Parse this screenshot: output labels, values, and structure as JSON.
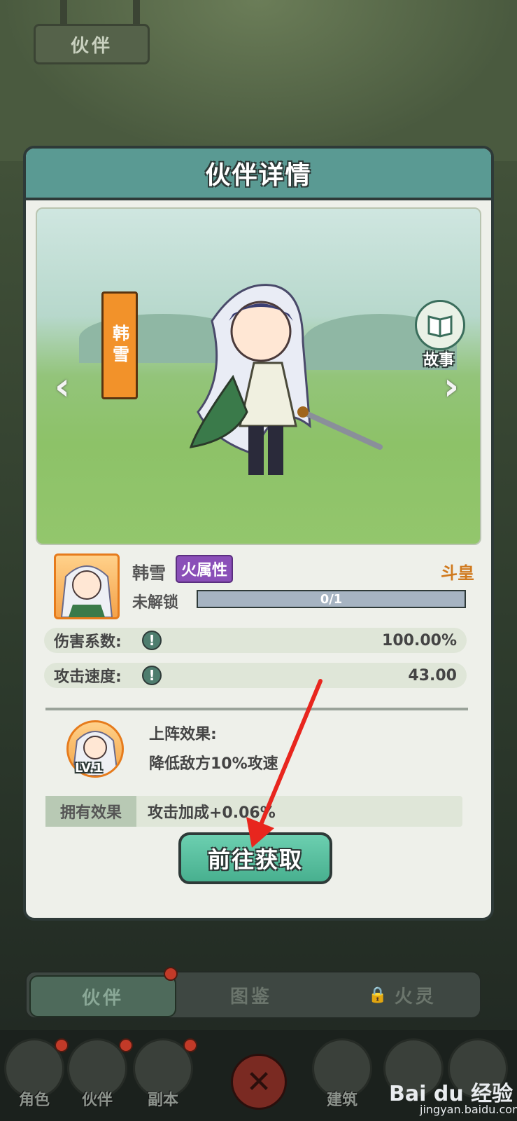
{
  "top_tab": {
    "label": "伙伴"
  },
  "dialog": {
    "title": "伙伴详情",
    "character_banner": "韩雪",
    "story_label": "故事"
  },
  "partner": {
    "name": "韩雪",
    "attribute": "火属性",
    "rank": "斗皇",
    "unlock_label": "未解锁",
    "unlock_progress": "0/1",
    "unlock_progress_fraction": 0
  },
  "stats": [
    {
      "label": "伤害系数:",
      "value": "100.00%"
    },
    {
      "label": "攻击速度:",
      "value": "43.00"
    }
  ],
  "skill": {
    "level": "LV.1",
    "effect_title": "上阵效果:",
    "effect_text": "降低敌方10%攻速"
  },
  "owned_effect": {
    "label": "拥有效果",
    "value": "攻击加成+0.06%"
  },
  "actions": {
    "goto_label": "前往获取"
  },
  "sub_tabs": [
    {
      "label": "伙伴",
      "active": true
    },
    {
      "label": "图鉴",
      "active": false
    },
    {
      "label": "火灵",
      "active": false
    }
  ],
  "bottom_nav": [
    {
      "label": "角色"
    },
    {
      "label": "伙伴"
    },
    {
      "label": "副本"
    },
    {
      "label": "建筑"
    }
  ],
  "watermark": {
    "main": "Bai du 经验",
    "sub": "jingyan.baidu.com"
  },
  "colors": {
    "accent": "#5a9a93",
    "attribute_badge": "#8a4fb8",
    "rank": "#d07a1e",
    "goto_button": "#48b08f",
    "annotation_arrow": "#e8261e"
  }
}
